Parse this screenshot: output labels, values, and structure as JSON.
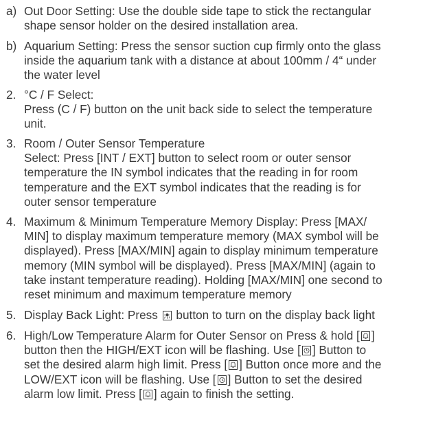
{
  "items": [
    {
      "marker": "a)",
      "lines": [
        [
          "Out Door Setting: Use the double side tape to stick the rectangular"
        ],
        [
          "shape sensor holder on the desired installation area."
        ]
      ]
    },
    {
      "marker": "b)",
      "lines": [
        [
          "Aquarium Setting: Press the sensor suction cup firmly onto the glass"
        ],
        [
          "inside the aquarium tank with a distance at about 100mm / 4“ under"
        ],
        [
          "the water level"
        ]
      ]
    },
    {
      "marker": "2.",
      "lines": [
        [
          "°C / F Select:"
        ],
        [
          "Press (C / F) button on the unit back side to select the temperature"
        ],
        [
          "unit."
        ]
      ]
    },
    {
      "marker": "3.",
      "lines": [
        [
          "Room / Outer Sensor Temperature"
        ],
        [
          "Select: Press [INT / EXT] button to select room or outer sensor"
        ],
        [
          "temperature the IN symbol indicates that the reading in for room"
        ],
        [
          "temperature and the EXT symbol indicates that the reading is for"
        ],
        [
          "outer sensor temperature"
        ]
      ]
    },
    {
      "marker": "4.",
      "lines": [
        [
          "Maximum & Minimum Temperature Memory Display: Press [MAX/"
        ],
        [
          "MIN] to display maximum temperature memory (MAX symbol will be"
        ],
        [
          "displayed). Press [MAX/MIN] again to display minimum temperature"
        ],
        [
          "memory (MIN symbol will be displayed). Press [MAX/MIN] (again to"
        ],
        [
          "take instant temperature reading). Holding [MAX/MIN] one second to"
        ],
        [
          "reset minimum and maximum temperature memory"
        ]
      ]
    },
    {
      "marker": "5.",
      "lines": [
        [
          "Display Back Light: Press ",
          "light",
          " button to turn on the display back light"
        ]
      ]
    },
    {
      "marker": "6.",
      "lines": [
        [
          "High/Low Temperature Alarm for Outer Sensor on Press & hold [",
          "bell",
          "]"
        ],
        [
          "button then the HIGH/EXT icon will be flashing. Use [",
          "clock",
          "] Button to"
        ],
        [
          "set the desired alarm high limit. Press [",
          "bell",
          "] Button once more and the"
        ],
        [
          "LOW/EXT icon will be flashing. Use [",
          "clock",
          "] Button to set the desired"
        ],
        [
          "alarm low limit. Press [",
          "bell",
          "] again to finish the setting."
        ]
      ]
    }
  ],
  "icons": {
    "light": "backlight-icon",
    "bell": "alarm-bell-icon",
    "clock": "clock-icon"
  }
}
